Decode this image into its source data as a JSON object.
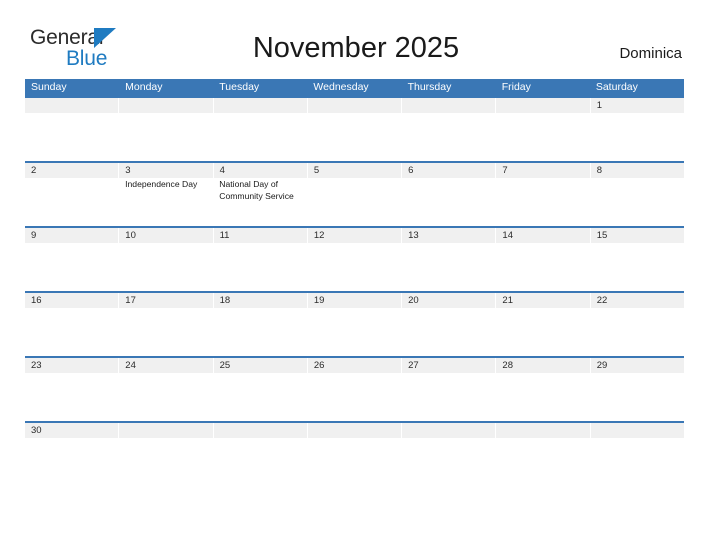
{
  "logo": {
    "text_primary": "General",
    "text_secondary": "Blue",
    "triangle_icon": "blue-triangle-icon",
    "color_primary": "#2b2b2b",
    "color_secondary": "#1F7BC1"
  },
  "header": {
    "title": "November 2025",
    "country": "Dominica"
  },
  "theme": {
    "header_blue": "#3A77B5",
    "row_gray": "#F0F0F0",
    "accent_blue": "#1F7BC1",
    "text_dark": "#1a1a1a"
  },
  "weekdays": [
    "Sunday",
    "Monday",
    "Tuesday",
    "Wednesday",
    "Thursday",
    "Friday",
    "Saturday"
  ],
  "weeks": [
    [
      {
        "day": "",
        "event": ""
      },
      {
        "day": "",
        "event": ""
      },
      {
        "day": "",
        "event": ""
      },
      {
        "day": "",
        "event": ""
      },
      {
        "day": "",
        "event": ""
      },
      {
        "day": "",
        "event": ""
      },
      {
        "day": "1",
        "event": ""
      }
    ],
    [
      {
        "day": "2",
        "event": ""
      },
      {
        "day": "3",
        "event": "Independence Day"
      },
      {
        "day": "4",
        "event": "National Day of Community Service"
      },
      {
        "day": "5",
        "event": ""
      },
      {
        "day": "6",
        "event": ""
      },
      {
        "day": "7",
        "event": ""
      },
      {
        "day": "8",
        "event": ""
      }
    ],
    [
      {
        "day": "9",
        "event": ""
      },
      {
        "day": "10",
        "event": ""
      },
      {
        "day": "11",
        "event": ""
      },
      {
        "day": "12",
        "event": ""
      },
      {
        "day": "13",
        "event": ""
      },
      {
        "day": "14",
        "event": ""
      },
      {
        "day": "15",
        "event": ""
      }
    ],
    [
      {
        "day": "16",
        "event": ""
      },
      {
        "day": "17",
        "event": ""
      },
      {
        "day": "18",
        "event": ""
      },
      {
        "day": "19",
        "event": ""
      },
      {
        "day": "20",
        "event": ""
      },
      {
        "day": "21",
        "event": ""
      },
      {
        "day": "22",
        "event": ""
      }
    ],
    [
      {
        "day": "23",
        "event": ""
      },
      {
        "day": "24",
        "event": ""
      },
      {
        "day": "25",
        "event": ""
      },
      {
        "day": "26",
        "event": ""
      },
      {
        "day": "27",
        "event": ""
      },
      {
        "day": "28",
        "event": ""
      },
      {
        "day": "29",
        "event": ""
      }
    ],
    [
      {
        "day": "30",
        "event": ""
      },
      {
        "day": "",
        "event": ""
      },
      {
        "day": "",
        "event": ""
      },
      {
        "day": "",
        "event": ""
      },
      {
        "day": "",
        "event": ""
      },
      {
        "day": "",
        "event": ""
      },
      {
        "day": "",
        "event": ""
      }
    ]
  ]
}
